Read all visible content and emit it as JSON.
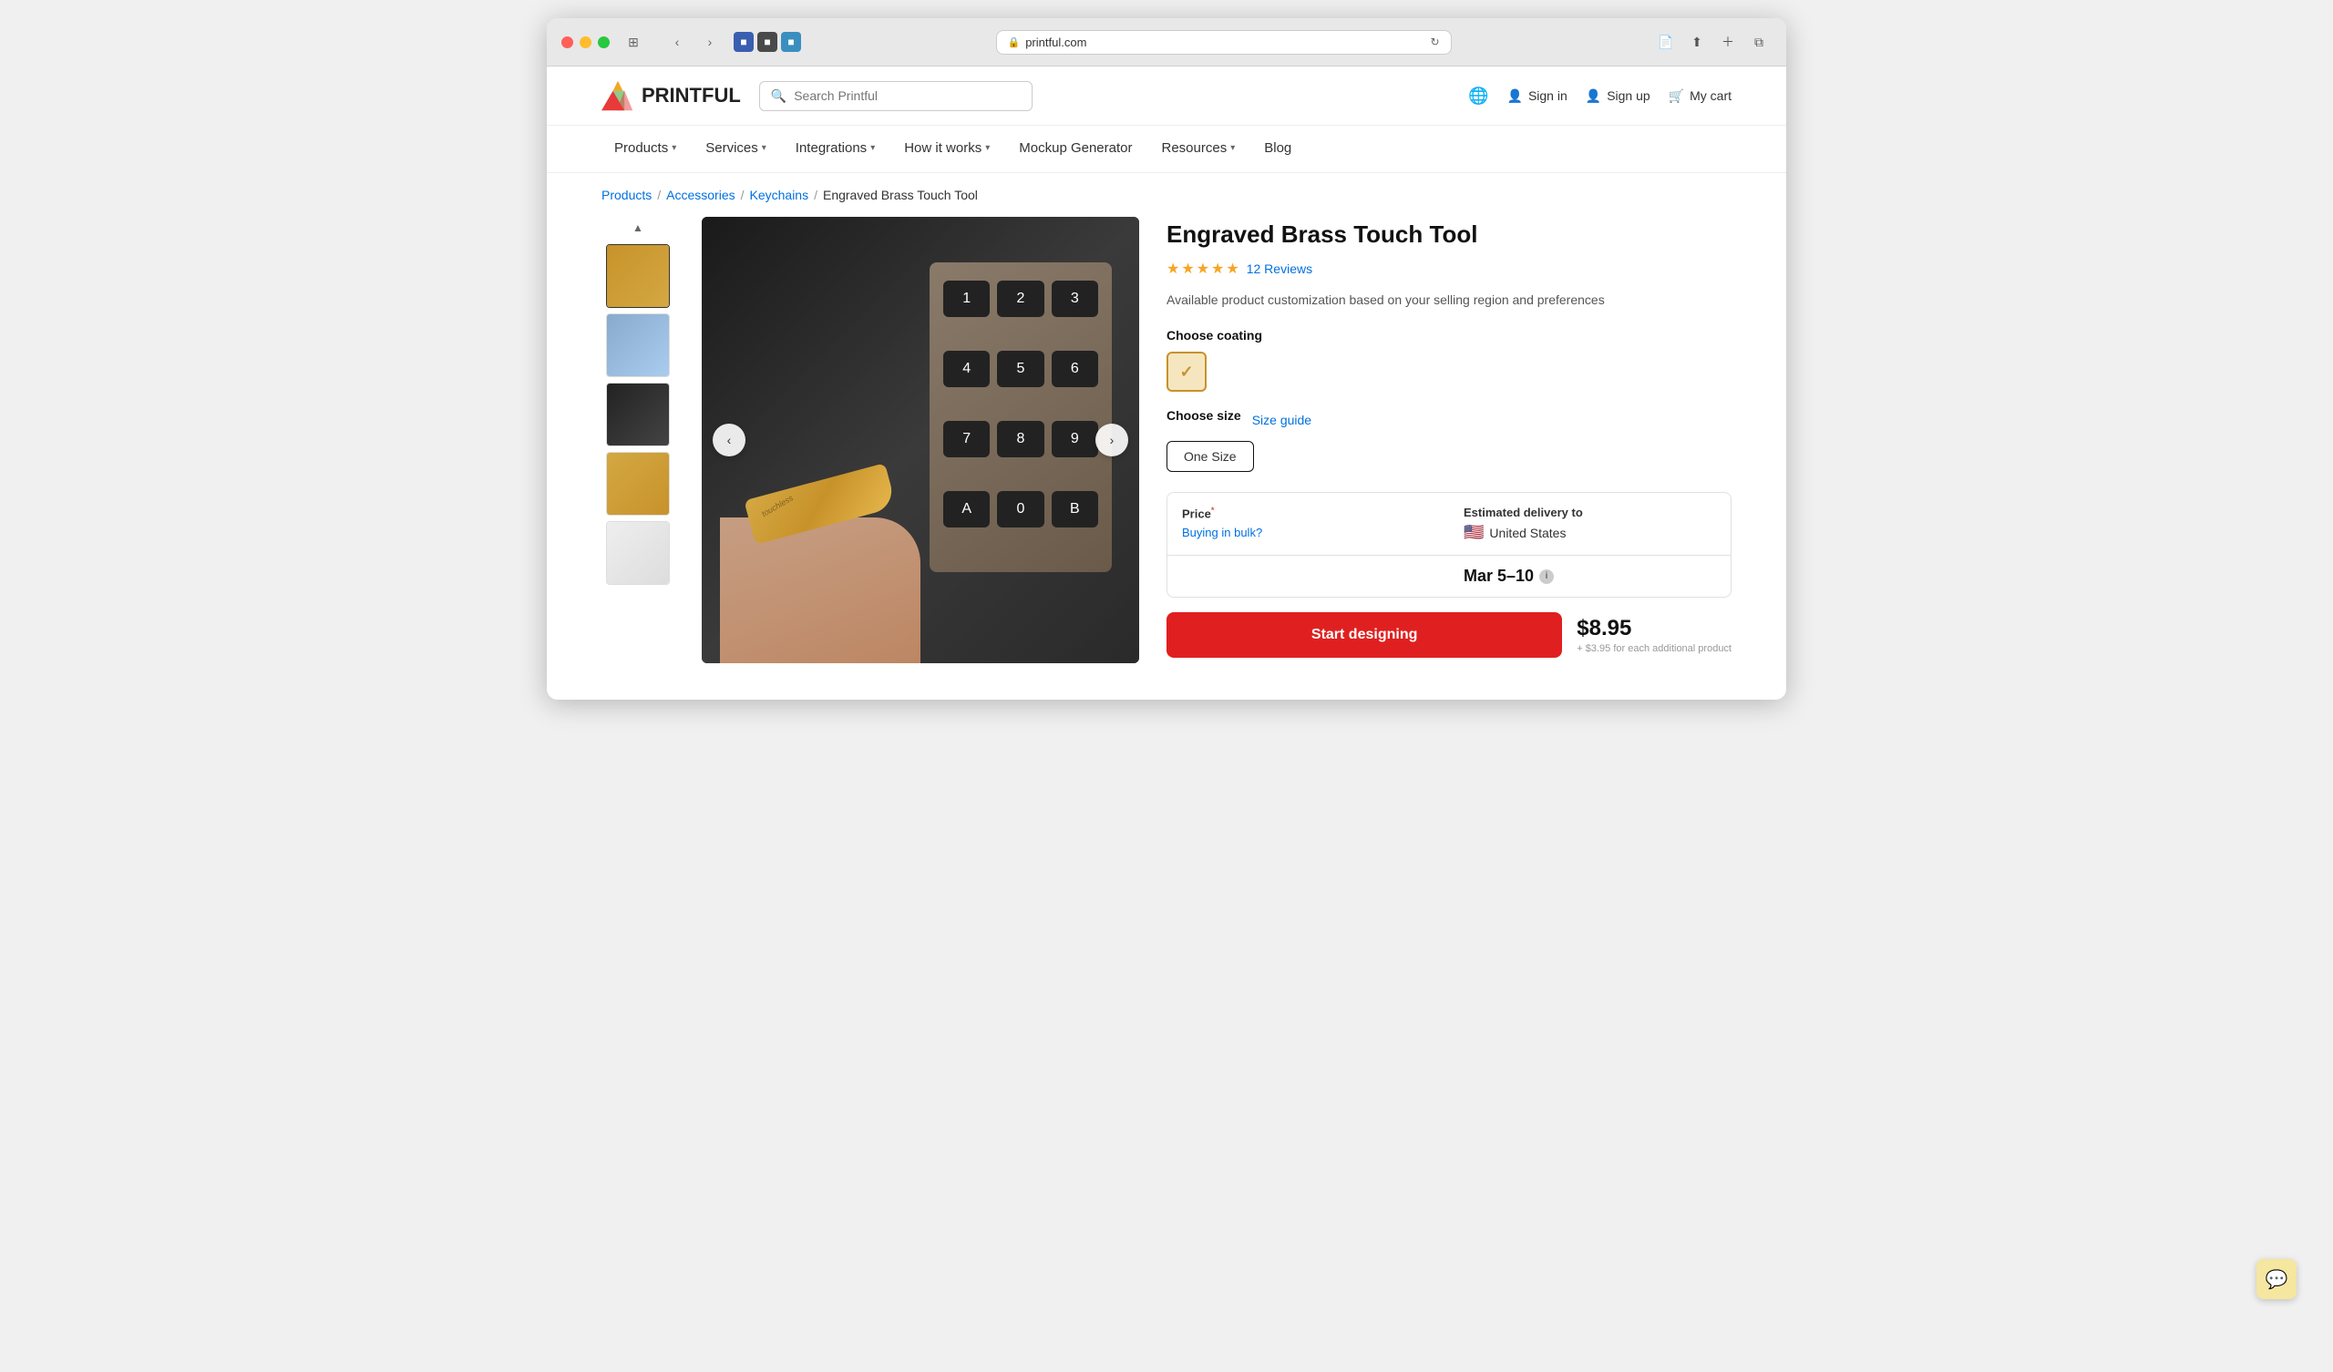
{
  "browser": {
    "url": "printful.com",
    "url_display": "printful.com"
  },
  "header": {
    "logo_text": "PRINTFUL",
    "search_placeholder": "Search Printful",
    "globe_label": "Globe",
    "sign_in": "Sign in",
    "sign_up": "Sign up",
    "cart": "My cart"
  },
  "nav": {
    "items": [
      {
        "label": "Products",
        "has_dropdown": true
      },
      {
        "label": "Services",
        "has_dropdown": true
      },
      {
        "label": "Integrations",
        "has_dropdown": true
      },
      {
        "label": "How it works",
        "has_dropdown": true
      },
      {
        "label": "Mockup Generator",
        "has_dropdown": false
      },
      {
        "label": "Resources",
        "has_dropdown": true
      },
      {
        "label": "Blog",
        "has_dropdown": false
      }
    ]
  },
  "breadcrumb": {
    "items": [
      {
        "label": "Products",
        "href": "#"
      },
      {
        "label": "Accessories",
        "href": "#"
      },
      {
        "label": "Keychains",
        "href": "#"
      },
      {
        "label": "Engraved Brass Touch Tool",
        "current": true
      }
    ]
  },
  "product": {
    "title": "Engraved Brass Touch Tool",
    "rating": 4.5,
    "review_count": "12 Reviews",
    "description": "Available product customization based on your selling region and preferences",
    "choose_coating_label": "Choose coating",
    "choose_size_label": "Choose size",
    "size_guide": "Size guide",
    "sizes": [
      "One Size"
    ],
    "selected_size": "One Size",
    "price_label": "Price",
    "price_asterisk": "*",
    "bulk_link": "Buying in bulk?",
    "delivery_label": "Estimated delivery to",
    "delivery_country": "United States",
    "delivery_date": "Mar 5–10",
    "price": "$8.95",
    "price_note": "+ $3.95 for each additional product",
    "start_designing": "Start designing"
  },
  "thumbnails": [
    {
      "alt": "Brass tool hand holding"
    },
    {
      "alt": "Person holding keychains"
    },
    {
      "alt": "Brass tool on dark background"
    },
    {
      "alt": "Brass tool flat"
    },
    {
      "alt": "Additional view"
    }
  ],
  "chat": {
    "icon": "💬"
  }
}
